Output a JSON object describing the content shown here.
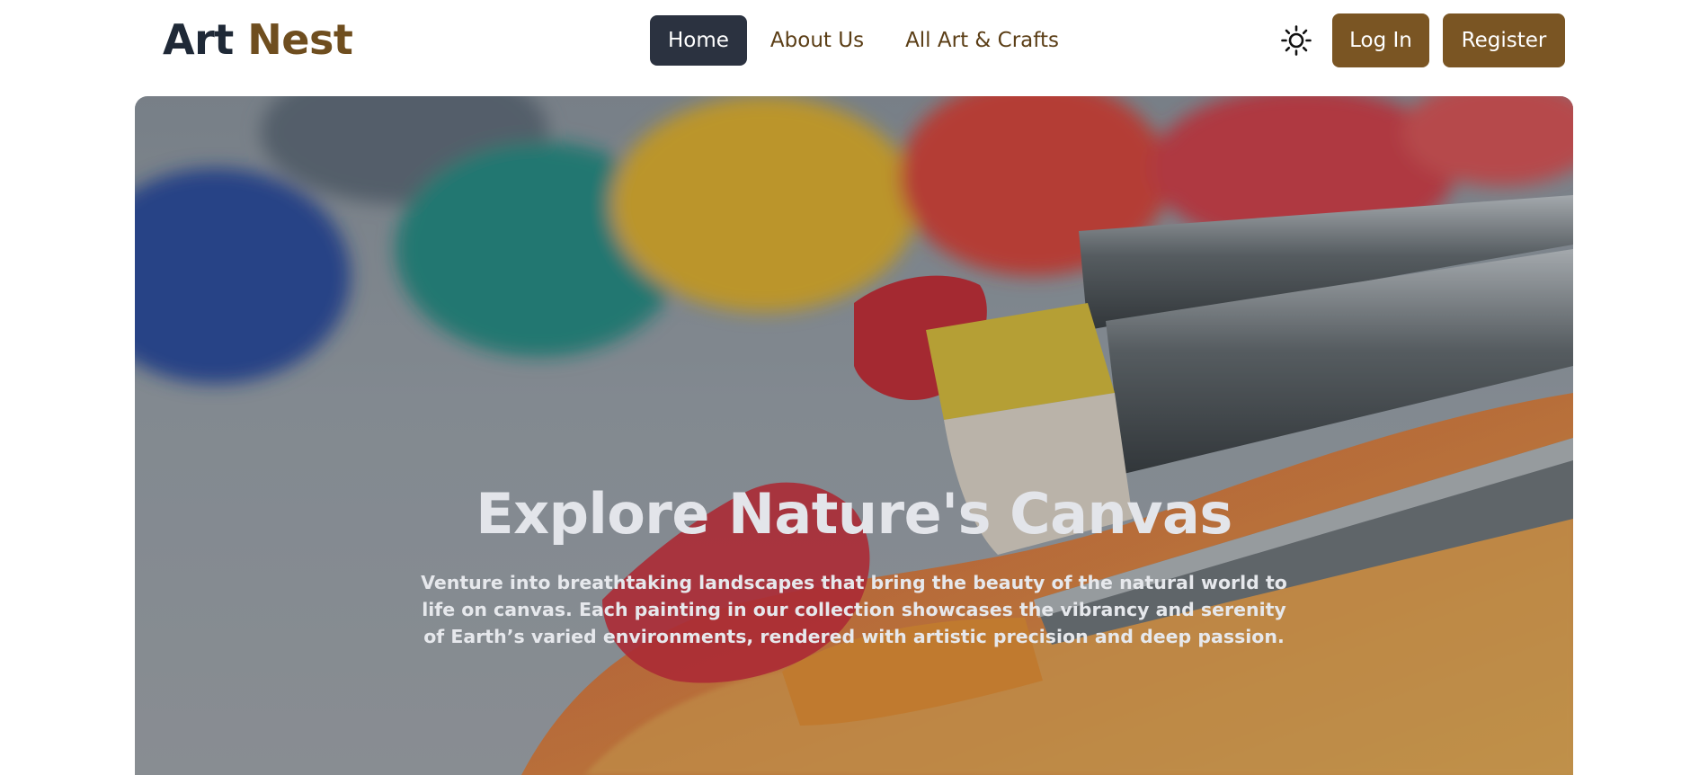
{
  "brand": {
    "word1": "Art",
    "word2": "Nest"
  },
  "nav": {
    "items": [
      {
        "label": "Home",
        "active": true
      },
      {
        "label": "About Us",
        "active": false
      },
      {
        "label": "All Art & Crafts",
        "active": false
      }
    ]
  },
  "actions": {
    "theme_icon": "sun-icon",
    "login_label": "Log In",
    "register_label": "Register"
  },
  "hero": {
    "title": "Explore Nature's Canvas",
    "text": "Venture into breathtaking landscapes that bring the beauty of the natural world to life on canvas. Each painting in our collection showcases the vibrancy and serenity of Earth’s varied environments, rendered with artistic precision and deep passion."
  },
  "colors": {
    "brand_dark": "#1f2937",
    "brand_accent": "#6f4e1f",
    "active_nav_bg": "#2b3240",
    "button_bg": "#7a5523"
  }
}
